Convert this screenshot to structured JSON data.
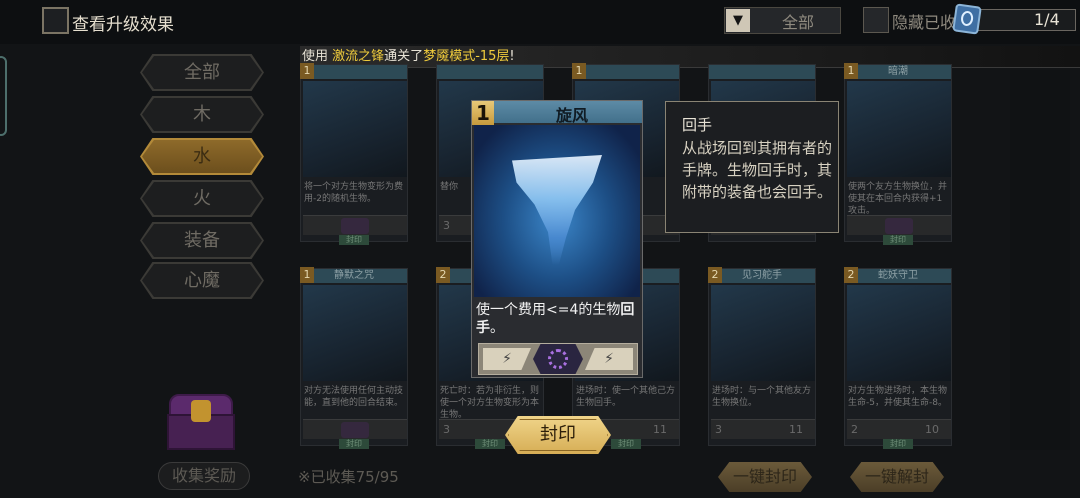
{
  "header": {
    "upgrade_label": "查看升级效果",
    "filter_value": "全部",
    "hide_label": "隐藏已收",
    "page": "1/4"
  },
  "announcement": {
    "prefix": "使用",
    "hero": "激流之锋",
    "middle": "通关了",
    "mode": "梦魇模式-15层",
    "suffix": "!"
  },
  "sidebar": {
    "tabs": [
      "全部",
      "木",
      "水",
      "火",
      "装备",
      "心魔"
    ],
    "active": "水",
    "collect_reward": "收集奖励",
    "collected": "※已收集75/95"
  },
  "grid": {
    "cards": [
      {
        "cost": "1",
        "name": "",
        "desc": "将一个对方生物变形为费用-2的随机生物。",
        "button": "封印"
      },
      {
        "cost": "",
        "name": "",
        "desc": "替你",
        "stat_left": "3",
        "button": ""
      },
      {
        "cost": "1",
        "name": "",
        "desc": "",
        "button": "封印"
      },
      {
        "cost": "1",
        "name": "暗潮",
        "desc": "使两个友方生物换位，并使其在本回合内获得+1攻击。",
        "button": "封印"
      },
      {
        "cost": "1",
        "name": "静默之咒",
        "desc": "对方无法使用任何主动技能，直到他的回合结束。",
        "button": "封印"
      },
      {
        "cost": "2",
        "name": "",
        "desc": "死亡时：若为非衍生，则使一个对方生物变形为本生物。",
        "stat_left": "3",
        "button": "封印"
      },
      {
        "cost": "",
        "name": "",
        "desc": "进场时：使一个其他己方生物回手。",
        "stat_right": "11",
        "button": "封印"
      },
      {
        "cost": "2",
        "name": "见习舵手",
        "desc": "进场时：与一个其他友方生物换位。",
        "stat_left": "3",
        "stat_right": "11",
        "button": ""
      },
      {
        "cost": "2",
        "name": "蛇妖守卫",
        "desc": "对方生物进场时，本生物生命-5，并使其生命-8。",
        "stat_left": "2",
        "stat_right": "10",
        "button": "封印"
      }
    ]
  },
  "popup_card": {
    "cost": "1",
    "name": "旋风",
    "desc_main": "使一个费用<=4的生物",
    "desc_keyword": "回手",
    "desc_end": "。"
  },
  "tooltip": {
    "title": "回手",
    "body": "从战场回到其拥有者的手牌。生物回手时，其附带的装备也会回手。"
  },
  "buttons": {
    "seal": "封印",
    "seal_all": "一键封印",
    "unseal_all": "一键解封"
  }
}
